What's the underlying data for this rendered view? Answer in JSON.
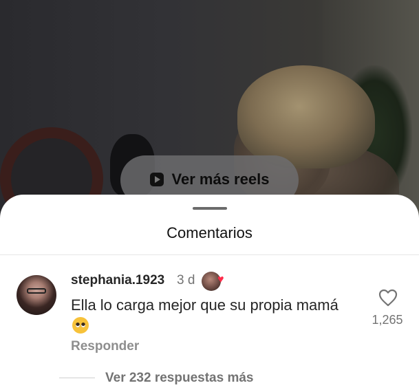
{
  "reels_button": {
    "label": "Ver más reels",
    "icon": "play-square-icon"
  },
  "sheet": {
    "title": "Comentarios"
  },
  "comment": {
    "username": "stephania.1923",
    "time": "3 d",
    "text": "Ella lo carga mejor que su propia mamá",
    "emoji": "pleading-face-icon",
    "creator_liked": true,
    "like_count": "1,265",
    "reply_label": "Responder",
    "view_replies_label": "Ver 232 respuestas más"
  },
  "colors": {
    "heart": "#ff2b4a",
    "secondary_text": "#737373",
    "primary_text": "#262626"
  }
}
